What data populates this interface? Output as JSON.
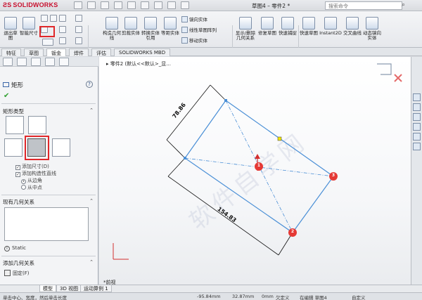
{
  "app": {
    "name": "SOLIDWORKS",
    "doc_title": "草图4 – 零件2 *",
    "search_placeholder": "搜索命令"
  },
  "ribbon": {
    "exit_sketch": "退出草图",
    "smart_dim": "智能尺寸",
    "trim_entities": "剪裁实体",
    "convert_entities": "转换实体引用",
    "offset_entities": "等距实体",
    "mirror_entities": "镜向实体",
    "linear_pattern": "线性草图阵列",
    "move_entities": "移动实体",
    "display_relations": "显示/删除几何关系",
    "repair_sketch": "修复草图",
    "quick_snaps": "快速捕捉",
    "rapid_sketch": "快速草图",
    "instant2d": "Instant2D",
    "shaded_contours": "交叉曲线",
    "dynamic_mirror": "动态镜向实体",
    "construction": "构造几何线"
  },
  "tabs": [
    "特征",
    "草图",
    "钣金",
    "焊件",
    "评估",
    "SOLIDWORKS MBD"
  ],
  "panel": {
    "title": "矩形",
    "rect_type_heading": "矩形类型",
    "add_dims": "添加尺寸(D)",
    "add_construction": "添加构造性直线",
    "from_corners": "从边角",
    "from_midpoint": "从中点",
    "existing_relations": "现有几何关系",
    "static": "Static",
    "add_relations": "添加几何关系",
    "fix": "固定(F)"
  },
  "viewport": {
    "breadcrumb": "零件2 (默认<<默认>_显...",
    "dim_top": "78.86",
    "dim_bottom": "154.83",
    "point_labels": [
      "1",
      "2",
      "3"
    ],
    "view_label": "*前视"
  },
  "bottom_tabs": [
    "模型",
    "3D 视图",
    "运动算例 1"
  ],
  "status": {
    "hint": "单击中心、宽度，然后单击长度",
    "x": "-95.84mm",
    "y": "32.87mm",
    "z": "0mm",
    "state": "欠定义",
    "editing": "在编辑 草图4",
    "units": "自定义"
  },
  "colors": {
    "accent_red": "#e0282a",
    "sketch_blue": "#4a8fd6",
    "point_red": "#e53935"
  }
}
